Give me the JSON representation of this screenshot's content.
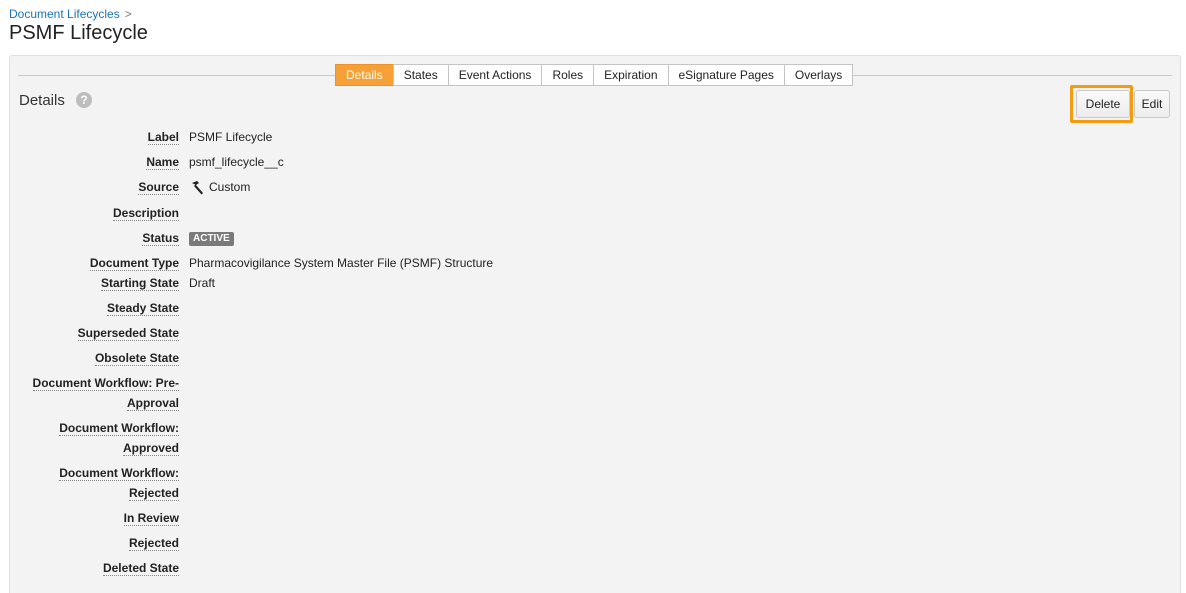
{
  "breadcrumb": {
    "parent": "Document Lifecycles",
    "separator": ">"
  },
  "page_title": "PSMF Lifecycle",
  "tabs": [
    {
      "label": "Details",
      "active": true
    },
    {
      "label": "States"
    },
    {
      "label": "Event Actions"
    },
    {
      "label": "Roles"
    },
    {
      "label": "Expiration"
    },
    {
      "label": "eSignature Pages"
    },
    {
      "label": "Overlays"
    }
  ],
  "section": {
    "title": "Details",
    "help_icon": "?"
  },
  "actions": {
    "delete_label": "Delete",
    "edit_label": "Edit"
  },
  "fields": {
    "label": {
      "label": "Label",
      "value": "PSMF Lifecycle"
    },
    "name": {
      "label": "Name",
      "value": "psmf_lifecycle__c"
    },
    "source": {
      "label": "Source",
      "value": "Custom",
      "icon": "hammer-icon"
    },
    "description": {
      "label": "Description",
      "value": ""
    },
    "status": {
      "label": "Status",
      "value": "ACTIVE"
    },
    "document_type": {
      "label": "Document Type",
      "value": "Pharmacovigilance System Master File (PSMF) Structure"
    },
    "starting_state": {
      "label": "Starting State",
      "value": "Draft"
    },
    "steady_state": {
      "label": "Steady State",
      "value": ""
    },
    "superseded_state": {
      "label": "Superseded State",
      "value": ""
    },
    "obsolete_state": {
      "label": "Obsolete State",
      "value": ""
    },
    "workflow_pre_approval": {
      "label_line1": "Document Workflow: Pre-",
      "label_line2": "Approval",
      "value": ""
    },
    "workflow_approved": {
      "label_line1": "Document Workflow:",
      "label_line2": "Approved",
      "value": ""
    },
    "workflow_rejected": {
      "label_line1": "Document Workflow:",
      "label_line2": "Rejected",
      "value": ""
    },
    "in_review": {
      "label": "In Review",
      "value": ""
    },
    "rejected": {
      "label": "Rejected",
      "value": ""
    },
    "deleted_state": {
      "label": "Deleted State",
      "value": ""
    }
  },
  "colors": {
    "accent": "#f6a137",
    "link": "#1a73b8",
    "highlight": "#f39c12",
    "badge": "#7a7a7a"
  }
}
